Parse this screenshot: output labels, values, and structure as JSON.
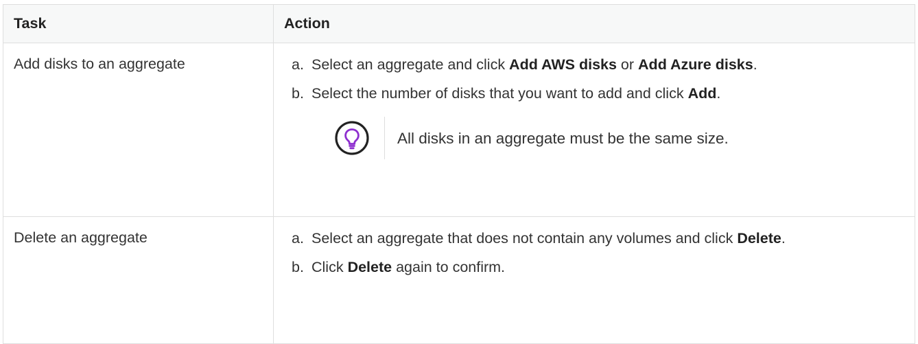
{
  "table": {
    "headers": {
      "task": "Task",
      "action": "Action"
    },
    "rows": [
      {
        "task": "Add disks to an aggregate",
        "steps": [
          {
            "marker": "a.",
            "parts": [
              "Select an aggregate and click ",
              "Add AWS disks",
              " or ",
              "Add Azure disks",
              "."
            ]
          },
          {
            "marker": "b.",
            "parts": [
              "Select the number of disks that you want to add and click ",
              "Add",
              "."
            ]
          }
        ],
        "tip": {
          "icon": "lightbulb-icon",
          "text": "All disks in an aggregate must be the same size."
        }
      },
      {
        "task": "Delete an aggregate",
        "steps": [
          {
            "marker": "a.",
            "parts": [
              "Select an aggregate that does not contain any volumes and click ",
              "Delete",
              "."
            ]
          },
          {
            "marker": "b.",
            "parts": [
              "Click ",
              "Delete",
              " again to confirm."
            ]
          }
        ]
      }
    ]
  },
  "colors": {
    "tip_icon": "#8e2fcf",
    "border": "#dedede",
    "header_bg": "#f7f8f8"
  }
}
